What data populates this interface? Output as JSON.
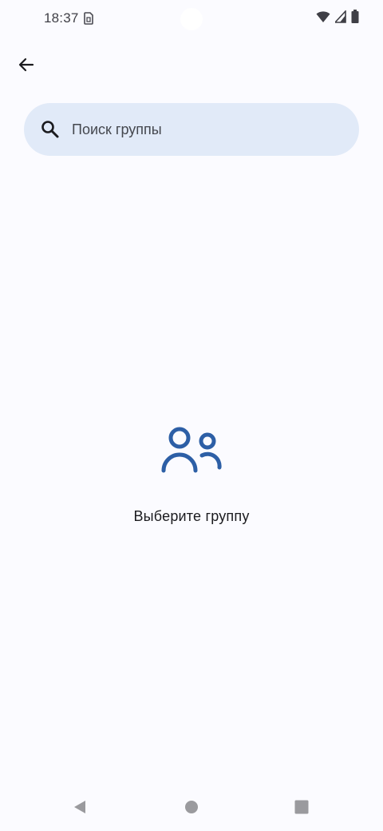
{
  "status_bar": {
    "time": "18:37",
    "icons": [
      "sim-card-icon",
      "wifi-icon",
      "signal-icon",
      "battery-icon"
    ]
  },
  "top_bar": {
    "back_icon": "arrow-back-icon"
  },
  "search": {
    "placeholder": "Поиск группы",
    "value": "",
    "icon": "search-icon"
  },
  "empty_state": {
    "icon": "group-icon",
    "label": "Выберите группу"
  },
  "nav_bar": {
    "buttons": [
      "back-triangle-icon",
      "home-circle-icon",
      "recents-square-icon"
    ]
  },
  "colors": {
    "background": "#fbfbff",
    "search_background": "#e1eaf8",
    "accent_icon": "#2d5fa6",
    "text_primary": "#1b1b1f",
    "text_secondary": "#44474e",
    "nav_icon": "#9a9a9e"
  }
}
